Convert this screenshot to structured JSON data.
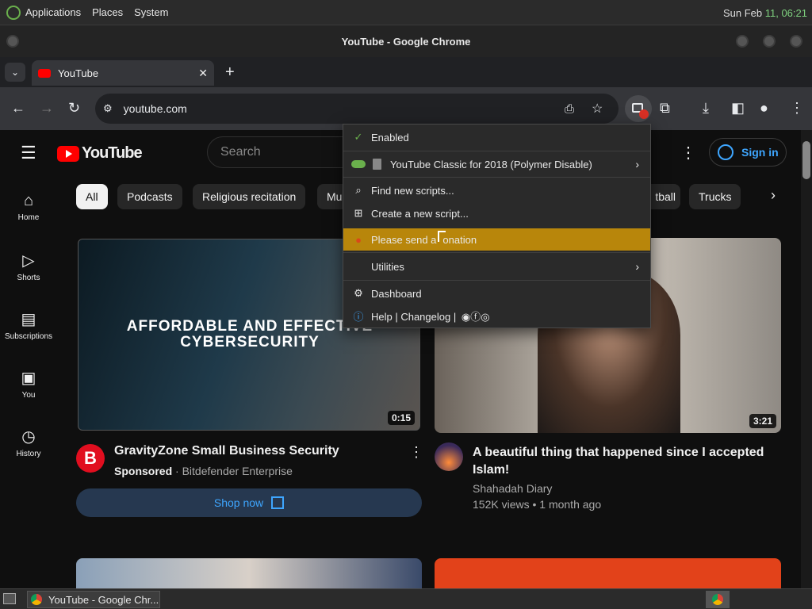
{
  "os_panel": {
    "menus": [
      "Applications",
      "Places",
      "System"
    ],
    "date": "Sun Feb",
    "time": "11, 06:21"
  },
  "window": {
    "title": "YouTube - Google Chrome"
  },
  "browser": {
    "tab_title": "YouTube",
    "url": "youtube.com",
    "icons": [
      "tab-list-icon",
      "youtube-favicon",
      "close-icon",
      "plus-icon",
      "back-icon",
      "forward-icon",
      "reload-icon",
      "site-info-icon",
      "install-icon",
      "star-icon",
      "userscript-manager-icon",
      "extensions-icon",
      "download-icon",
      "side-panel-icon",
      "profile-icon",
      "kebab-menu-icon"
    ]
  },
  "youtube": {
    "logo_text": "YouTube",
    "search_placeholder": "Search",
    "sign_in": "Sign in",
    "chips": [
      "All",
      "Podcasts",
      "Religious recitation",
      "Mu",
      "tball",
      "Trucks"
    ],
    "nav": [
      {
        "label": "Home",
        "icon": "home-icon"
      },
      {
        "label": "Shorts",
        "icon": "shorts-icon"
      },
      {
        "label": "Subscriptions",
        "icon": "subscriptions-icon"
      },
      {
        "label": "You",
        "icon": "you-icon"
      },
      {
        "label": "History",
        "icon": "history-icon"
      }
    ],
    "videos": [
      {
        "thumb_text_1": "AFFORDABLE AND EFFECTIVE",
        "thumb_text_2": "CYBERSECURITY",
        "duration": "0:15",
        "channel_initial": "B",
        "title": "GravityZone Small Business Security",
        "sponsored": "Sponsored",
        "channel": "Bitdefender Enterprise",
        "cta": "Shop now"
      },
      {
        "duration": "3:21",
        "title_line1": "A beautiful thing that happened since I accepted",
        "title_line2": "Islam!",
        "channel": "Shahadah Diary",
        "meta": "152K views • 1 month ago"
      }
    ]
  },
  "popup_menu": {
    "items": [
      {
        "label": "Enabled",
        "icon": "check-icon"
      },
      {
        "label": "YouTube Classic for 2018 (Polymer Disable)",
        "icon": "script-toggle-icon"
      },
      {
        "label": "Find new scripts...",
        "icon": "search-icon"
      },
      {
        "label": "Create a new script...",
        "icon": "add-box-icon"
      },
      {
        "label": "Please send a donation",
        "icon": "donation-icon"
      },
      {
        "label": "Utilities",
        "icon": ""
      },
      {
        "label": "Dashboard",
        "icon": "gear-icon"
      },
      {
        "label": "Help | Changelog |",
        "icon": "info-icon"
      }
    ],
    "hover_label_visible": "Please send a",
    "hover_label_rest": "onation",
    "highlight_color": "#b8860b"
  },
  "taskbar": {
    "window_label": "YouTube - Google Chr..."
  },
  "colors": {
    "youtube_red": "#ff0000",
    "signin_blue": "#3ea6ff",
    "chrome_toolbar": "#35363a"
  }
}
